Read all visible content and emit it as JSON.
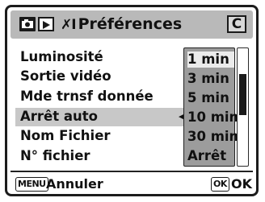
{
  "header": {
    "title": "Préférences",
    "setup_icon_glyph": "✗I",
    "custom_tab_label": "C",
    "tabs": [
      "camera-icon",
      "playback-icon",
      "setup-icon",
      "custom-tab"
    ]
  },
  "menu": {
    "items": [
      {
        "label": "Luminosité"
      },
      {
        "label": "Sortie vidéo"
      },
      {
        "label": "Mde trnsf donnée"
      },
      {
        "label": "Arrêt auto"
      },
      {
        "label": "Nom Fichier"
      },
      {
        "label": "N° fichier"
      }
    ],
    "selected_index": 3
  },
  "dropdown": {
    "options": [
      "1 min",
      "3 min",
      "5 min",
      "10 min",
      "30 min",
      "Arrêt"
    ],
    "highlighted_index": 0
  },
  "scrollbar": {
    "position": 0.33
  },
  "footer": {
    "menu_key": "MENU",
    "cancel_label": "Annuler",
    "ok_key": "OK",
    "ok_label": "OK"
  },
  "colors": {
    "header_bg": "#b9b9b9",
    "dropdown_bg": "#9c9c9c",
    "selected_row_bg": "#c8c8c8",
    "highlight_option_bg": "#ebebeb"
  }
}
